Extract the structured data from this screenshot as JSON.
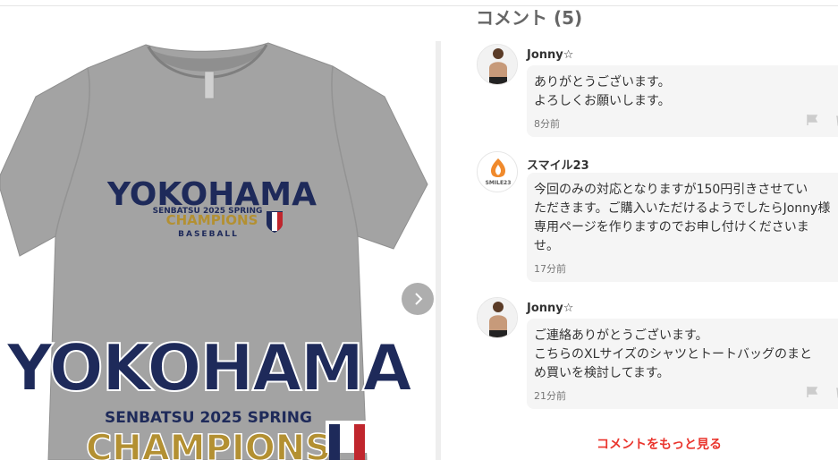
{
  "comments_header": {
    "title": "コメント (5)"
  },
  "product_image": {
    "shirt_color": "#a0a0a0",
    "print": {
      "small": {
        "city": "YOKOHAMA",
        "subtitle": "SENBATSU 2025 SPRING",
        "champions": "CHAMPIONS",
        "sport": "BASEBALL"
      },
      "large": {
        "city": "YOKOHAMA",
        "subtitle": "SENBATSU 2025 SPRING",
        "champions": "CHAMPIONS"
      },
      "navy": "#1e2a5a",
      "gold": "#b39032"
    },
    "next_icon": "chevron-right-icon"
  },
  "comments": [
    {
      "author": "Jonny☆",
      "avatar": "child-photo",
      "lines": [
        "ありがとうございます。",
        "よろしくお願いします。"
      ],
      "time": "8分前"
    },
    {
      "author": "スマイル23",
      "avatar": "smile23-logo",
      "avatar_text": "SMILE23",
      "lines": [
        "今回のみの対応となりますが150円引きさせてい",
        "ただきます。ご購入いただけるようでしたらJonny様",
        "専用ページを作りますのでお申し付けくださいま",
        "せ。"
      ],
      "time": "17分前"
    },
    {
      "author": "Jonny☆",
      "avatar": "child-photo",
      "lines": [
        "ご連絡ありがとうございます。",
        "こちらのXLサイズのシャツとトートバッグのまと",
        "め買いを検討してます。"
      ],
      "time": "21分前"
    }
  ],
  "more_comments_link": "コメントをもっと見る",
  "colors": {
    "accent": "#ea352d",
    "bubble": "#f5f5f5"
  }
}
